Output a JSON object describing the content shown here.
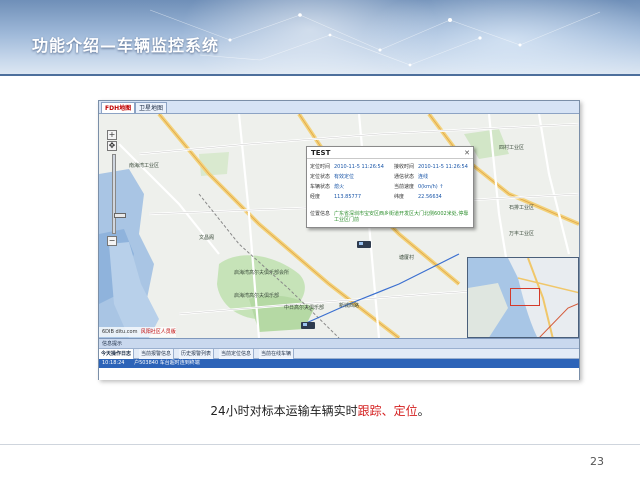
{
  "slide": {
    "title": "功能介绍—车辆监控系统",
    "caption_before": "24小时对标本运输车辆实时",
    "caption_hl1": "跟踪",
    "caption_sep": "、",
    "caption_hl2": "定位",
    "caption_after": "。",
    "page_number": "23",
    "accent_color": "#d42020"
  },
  "app": {
    "tabs": [
      {
        "label": "FDH地图",
        "active": true
      },
      {
        "label": "卫星地图",
        "active": false
      }
    ],
    "map_labels": [
      "文昌阁",
      "启海湾高尔夫俱乐部会所",
      "启海湾高尔夫俱乐部",
      "中日高尔夫俱乐部",
      "南海湾工业区",
      "新城西路",
      "塘厦村",
      "四村工业区",
      "石排工业区",
      "万丰工业区"
    ],
    "map_footer_left": "6DIB ditu.com",
    "map_footer_right": "风阳社区人员版",
    "popup": {
      "title": "TEST",
      "close": "✕",
      "rows": [
        {
          "k1": "定位时间",
          "v1": "2010-11-5 11:26:54",
          "k2": "接收时间",
          "v2": "2010-11-5 11:26:54"
        },
        {
          "k1": "定位状态",
          "v1": "有效定位",
          "k2": "通信状态",
          "v2": "连线"
        },
        {
          "k1": "车辆状态",
          "v1": "熄火",
          "k2": "当前速度",
          "v2": "0(km/h) ↑"
        },
        {
          "k1": "经度",
          "v1": "113.85777",
          "k2": "纬度",
          "v2": "22.56634"
        }
      ],
      "addr_label": "位置信息",
      "addr_value": "广东省深圳市宝安区西乡街道开发区大门北侧6002米处,停靠工业区门前"
    },
    "info_title": "信息提示",
    "bottom_tabs": [
      {
        "label": "今天操作日志",
        "active": true
      },
      {
        "label": "当前报警信息",
        "active": false
      },
      {
        "label": "历史报警列表",
        "active": false
      },
      {
        "label": "当前定位信息",
        "active": false
      },
      {
        "label": "当前在线车辆",
        "active": false
      }
    ],
    "log": {
      "time": "10:18:24",
      "text": "户503840 车台超时连到终端"
    }
  }
}
